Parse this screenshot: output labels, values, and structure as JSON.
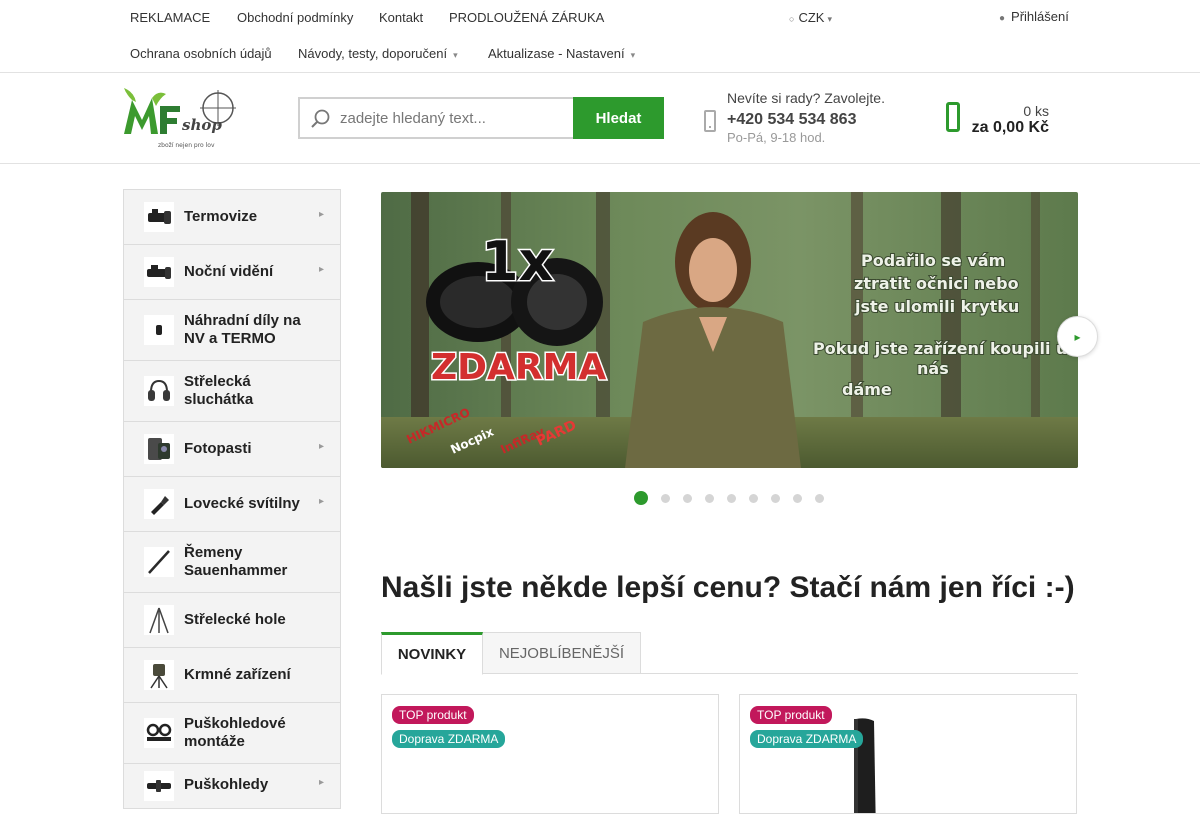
{
  "topnav": {
    "row1": [
      "REKLAMACE",
      "Obchodní podmínky",
      "Kontakt",
      "PRODLOUŽENÁ ZÁRUKA"
    ],
    "row2": [
      "Ochrana osobních údajů",
      "Návody, testy, doporučení",
      "Aktualizase - Nastavení"
    ],
    "currency": "CZK",
    "login": "Přihlášení"
  },
  "header": {
    "logo_text": "MF shop",
    "logo_tagline": "zboží nejen pro lov",
    "search_placeholder": "zadejte hledaný text...",
    "search_button": "Hledat",
    "help_question": "Nevíte si rady? Zavolejte.",
    "help_phone": "+420 534 534 863",
    "help_hours": "Po-Pá, 9-18 hod.",
    "cart_qty": "0 ks",
    "cart_total": "za 0,00 Kč"
  },
  "sidebar": {
    "categories": [
      {
        "label": "Termovize",
        "has_submenu": true
      },
      {
        "label": "Noční vidění",
        "has_submenu": true
      },
      {
        "label": "Náhradní díly na NV a TERMO",
        "has_submenu": false
      },
      {
        "label": "Střelecká sluchátka",
        "has_submenu": false
      },
      {
        "label": "Fotopasti",
        "has_submenu": true
      },
      {
        "label": "Lovecké svítilny",
        "has_submenu": true
      },
      {
        "label": "Řemeny Sauenhammer",
        "has_submenu": false
      },
      {
        "label": "Střelecké hole",
        "has_submenu": false
      },
      {
        "label": "Krmné zařízení",
        "has_submenu": false
      },
      {
        "label": "Puškohledové montáže",
        "has_submenu": false
      },
      {
        "label": "Puškohledy",
        "has_submenu": true
      }
    ]
  },
  "banner": {
    "big_text": "1x",
    "free_text": "ZDARMA",
    "right_text_lines": [
      "Podařilo se vám",
      "ztratit očnici nebo",
      "jste ulomili krytku"
    ],
    "right_text_lines2": [
      "Pokud jste zařízení koupili u",
      "nás",
      "dáme"
    ],
    "brands": [
      "HIKMICRO",
      "Nocpix",
      "InfiRay",
      "PARD"
    ],
    "slide_count": 9,
    "active_slide": 1
  },
  "main": {
    "headline": "Našli jste někde lepší cenu? Stačí nám jen říci :-)",
    "tabs": [
      "NOVINKY",
      "NEJOBLÍBENĚJŠÍ"
    ],
    "active_tab": 0,
    "products": [
      {
        "flags": [
          "TOP produkt",
          "Doprava ZDARMA"
        ]
      },
      {
        "flags": [
          "TOP produkt",
          "Doprava ZDARMA"
        ]
      }
    ]
  },
  "colors": {
    "accent_green": "#2d9a2d",
    "flag_top": "#c2185b",
    "flag_shipping": "#26a69a"
  }
}
